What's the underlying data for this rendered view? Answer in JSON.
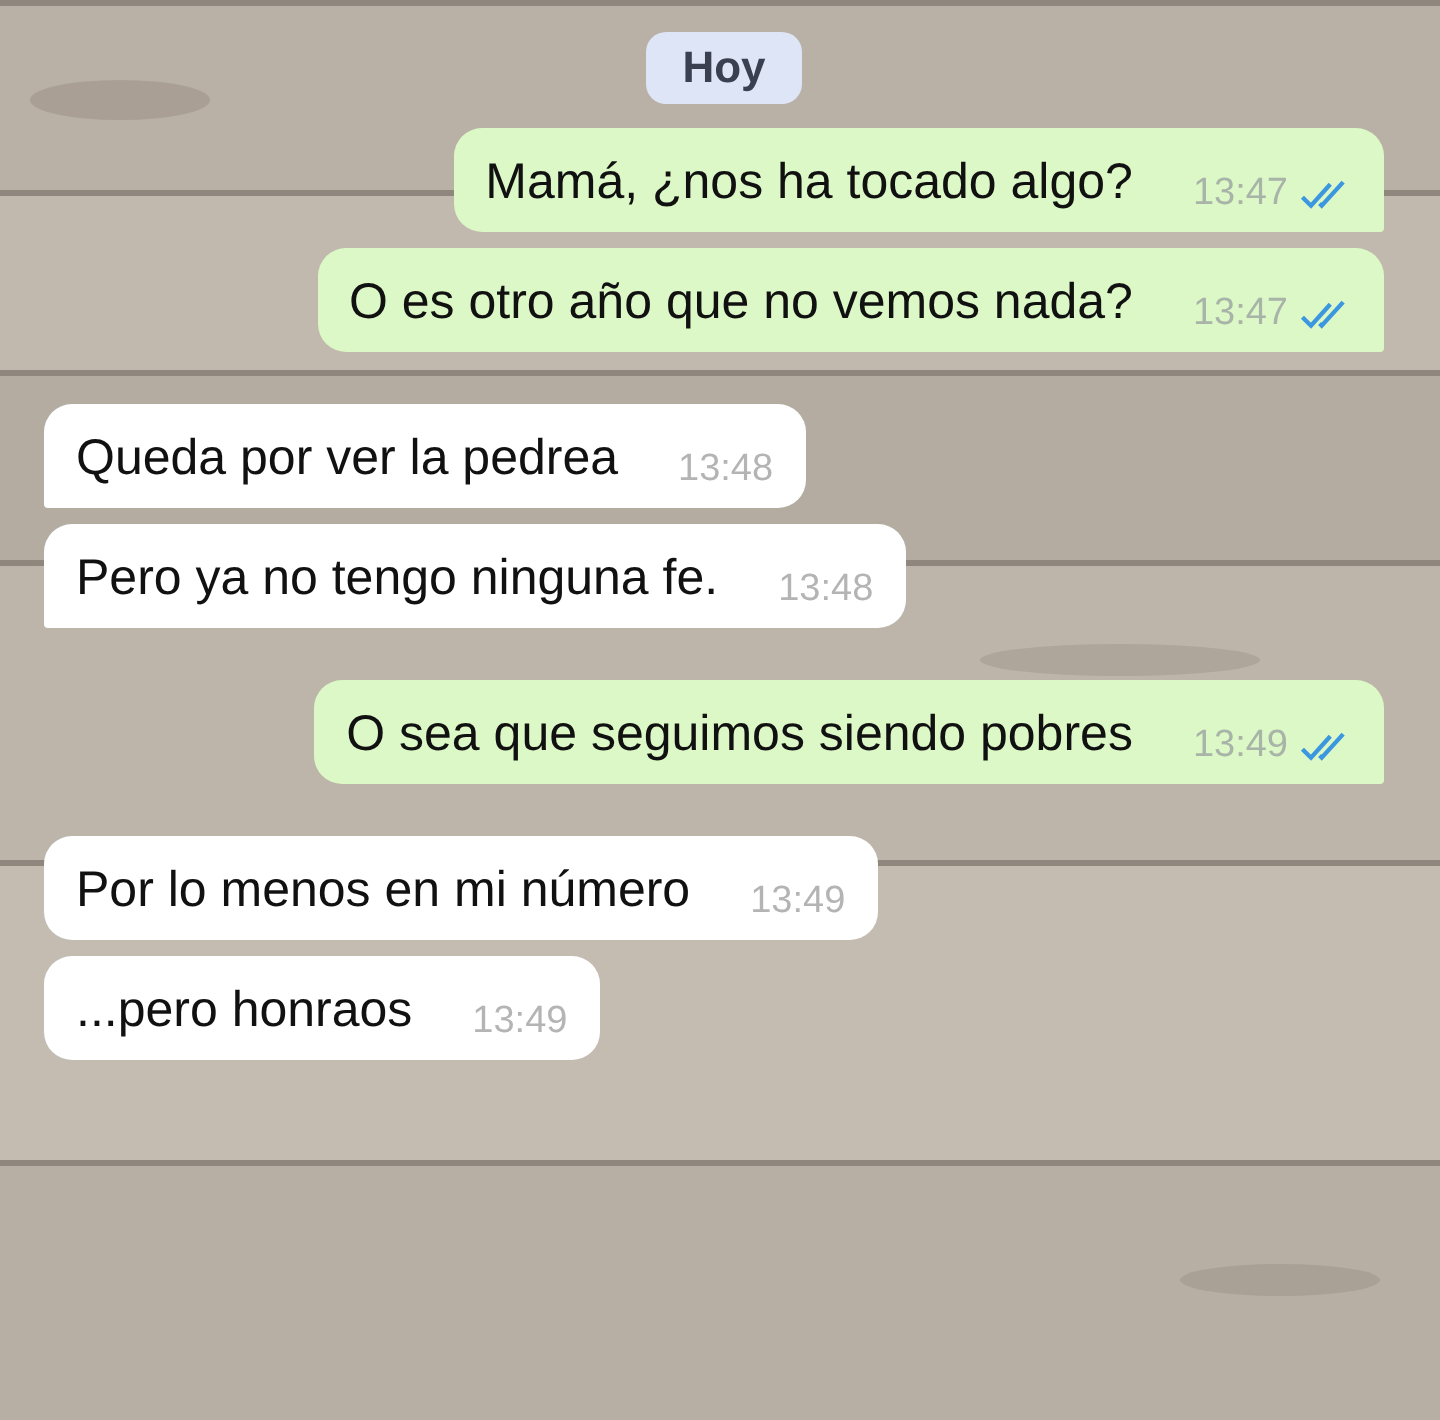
{
  "date_chip": "Hoy",
  "messages": [
    {
      "kind": "sent",
      "text": "Mamá, ¿nos ha tocado algo?",
      "time": "13:47",
      "read": true,
      "tail": true
    },
    {
      "kind": "sent",
      "text": "O es otro año que no vemos nada?",
      "time": "13:47",
      "read": true,
      "tail": true
    },
    {
      "kind": "received",
      "text": "Queda por ver la pedrea",
      "time": "13:48",
      "tail": true
    },
    {
      "kind": "received",
      "text": "Pero ya no tengo ninguna fe.",
      "time": "13:48",
      "tail": true
    },
    {
      "kind": "sent",
      "text": "O sea que seguimos siendo pobres",
      "time": "13:49",
      "read": true,
      "tail": true
    },
    {
      "kind": "received",
      "text": "Por lo menos en mi número",
      "time": "13:49",
      "tail": false
    },
    {
      "kind": "received",
      "text": "...pero honraos",
      "time": "13:49",
      "tail": false
    }
  ]
}
